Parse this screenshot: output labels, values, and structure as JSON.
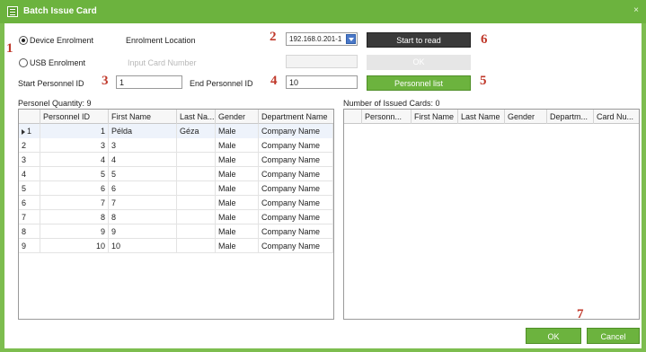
{
  "window": {
    "title": "Batch Issue Card",
    "close_glyph": "×"
  },
  "enrollment": {
    "device_label": "Device Enrolment",
    "usb_label": "USB Enrolment",
    "selected": "device",
    "location_label": "Enrolment Location",
    "location_value": "192.168.0.201-1",
    "card_number_label": "Input Card Number",
    "card_number_value": ""
  },
  "range": {
    "start_label": "Start Personnel ID",
    "start_value": "1",
    "end_label": "End Personnel ID",
    "end_value": "10"
  },
  "buttons": {
    "start_read": "Start to read",
    "ok_small": "OK",
    "personnel_list": "Personnel list",
    "ok": "OK",
    "cancel": "Cancel"
  },
  "markers": {
    "m1": "1",
    "m2": "2",
    "m3": "3",
    "m4": "4",
    "m5": "5",
    "m6": "6",
    "m7": "7"
  },
  "left_table": {
    "caption": "Personel Quantity: 9",
    "columns": [
      "Personnel ID",
      "First Name",
      "Last Na...",
      "Gender",
      "Department Name"
    ],
    "rows": [
      {
        "idx": "1",
        "id": "1",
        "first": "Példa",
        "last": "Géza",
        "gender": "Male",
        "dept": "Company Name"
      },
      {
        "idx": "2",
        "id": "3",
        "first": "3",
        "last": "",
        "gender": "Male",
        "dept": "Company Name"
      },
      {
        "idx": "3",
        "id": "4",
        "first": "4",
        "last": "",
        "gender": "Male",
        "dept": "Company Name"
      },
      {
        "idx": "4",
        "id": "5",
        "first": "5",
        "last": "",
        "gender": "Male",
        "dept": "Company Name"
      },
      {
        "idx": "5",
        "id": "6",
        "first": "6",
        "last": "",
        "gender": "Male",
        "dept": "Company Name"
      },
      {
        "idx": "6",
        "id": "7",
        "first": "7",
        "last": "",
        "gender": "Male",
        "dept": "Company Name"
      },
      {
        "idx": "7",
        "id": "8",
        "first": "8",
        "last": "",
        "gender": "Male",
        "dept": "Company Name"
      },
      {
        "idx": "8",
        "id": "9",
        "first": "9",
        "last": "",
        "gender": "Male",
        "dept": "Company Name"
      },
      {
        "idx": "9",
        "id": "10",
        "first": "10",
        "last": "",
        "gender": "Male",
        "dept": "Company Name"
      }
    ]
  },
  "right_table": {
    "caption": "Number of Issued Cards: 0",
    "columns": [
      "Personn...",
      "First Name",
      "Last Name",
      "Gender",
      "Departm...",
      "Card Nu..."
    ]
  },
  "colors": {
    "accent": "#6cb33e",
    "marker": "#c0392b",
    "dark_button": "#3a3a3a"
  }
}
